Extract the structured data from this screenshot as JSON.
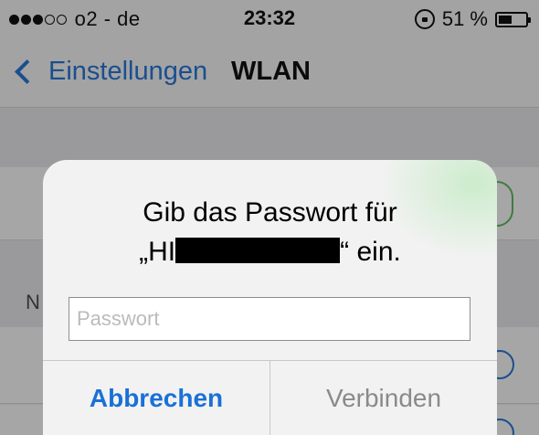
{
  "status_bar": {
    "carrier": "o2 - de",
    "time": "23:32",
    "battery_text": "51 %",
    "battery_level": 0.51
  },
  "nav": {
    "back_label": "Einstellungen",
    "title": "WLAN"
  },
  "background": {
    "section_letter": "N"
  },
  "alert": {
    "title_line1": "Gib das Passwort für",
    "title_prefix": "„HI",
    "title_suffix": "“ ein.",
    "password_placeholder": "Passwort",
    "password_value": "",
    "cancel_label": "Abbrechen",
    "connect_label": "Verbinden"
  },
  "colors": {
    "accent_blue": "#1971d6",
    "disabled_gray": "#8a8a8a"
  },
  "icons": [
    "signal-dots-icon",
    "rotation-lock-icon",
    "battery-icon",
    "chevron-left-icon",
    "info-icon"
  ]
}
